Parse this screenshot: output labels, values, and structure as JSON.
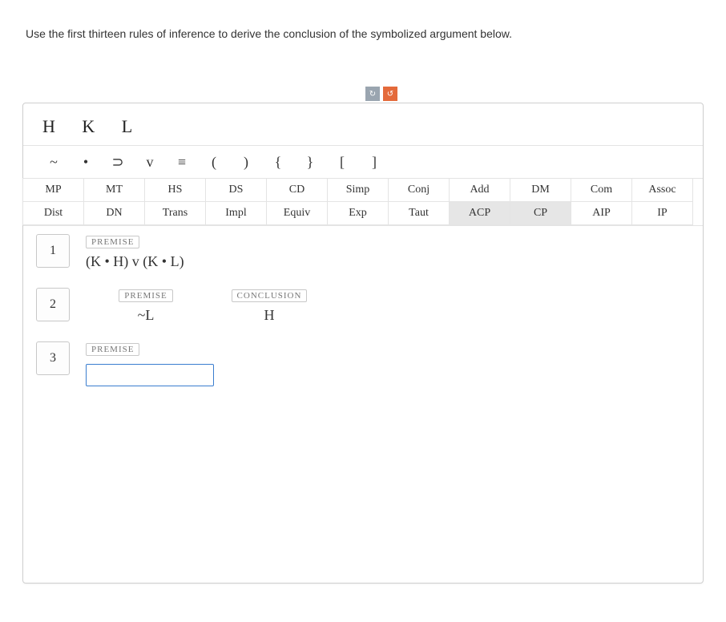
{
  "instructions": "Use the first thirteen rules of inference to derive the conclusion of the symbolized argument below.",
  "variables": "H  K  L",
  "symbols": [
    "~",
    "•",
    "⊃",
    "v",
    "≡",
    "(",
    ")",
    "{",
    "}",
    "[",
    "]"
  ],
  "rules_row1": [
    "MP",
    "MT",
    "HS",
    "DS",
    "CD",
    "Simp",
    "Conj",
    "Add",
    "DM",
    "Com",
    "Assoc"
  ],
  "rules_row2": [
    "Dist",
    "DN",
    "Trans",
    "Impl",
    "Equiv",
    "Exp",
    "Taut",
    "ACP",
    "CP",
    "AIP",
    "IP"
  ],
  "selected_rules": [
    "ACP",
    "CP"
  ],
  "lines": {
    "l1": {
      "num": "1",
      "tag": "PREMISE",
      "formula": "(K • H) v (K • L)"
    },
    "l2": {
      "num": "2",
      "tagA": "PREMISE",
      "formulaA": "~L",
      "tagB": "CONCLUSION",
      "formulaB": "H"
    },
    "l3": {
      "num": "3",
      "tag": "PREMISE"
    }
  }
}
